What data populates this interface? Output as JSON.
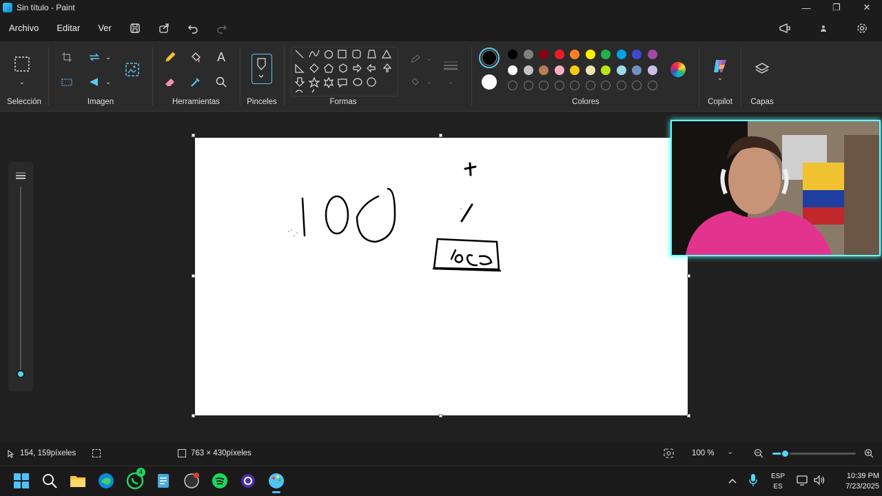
{
  "window": {
    "title": "Sin título - Paint",
    "minimize": "—",
    "maximize": "❐",
    "close": "✕"
  },
  "menu": {
    "file": "Archivo",
    "edit": "Editar",
    "view": "Ver"
  },
  "ribbon": {
    "selection": "Selección",
    "image": "Imagen",
    "tools": "Herramientas",
    "brushes": "Pinceles",
    "shapes": "Formas",
    "colors": "Colores",
    "copilot": "Copilot",
    "layers": "Capas"
  },
  "colors": {
    "primary": "#000000",
    "secondary": "#ffffff",
    "row1": [
      "#000000",
      "#7f7f7f",
      "#880015",
      "#ed1c24",
      "#ff7f27",
      "#fff200",
      "#22b14c",
      "#00a2e8",
      "#3f48cc",
      "#a349a4"
    ],
    "row2": [
      "#ffffff",
      "#c3c3c3",
      "#b97a57",
      "#ffaec9",
      "#ffc90e",
      "#efe4b0",
      "#b5e61d",
      "#99d9ea",
      "#7092be",
      "#c8bfe7"
    ]
  },
  "canvas_text": {
    "number": "100",
    "plus": "+",
    "slash": "/",
    "boxed": "%"
  },
  "status": {
    "cursor_pos": "154, 159píxeles",
    "canvas_size": "763 × 430píxeles",
    "zoom": "100 %"
  },
  "taskbar": {
    "lang_top": "ESP",
    "lang_bottom": "ES",
    "time": "10:39 PM",
    "date": "7/23/2025",
    "whatsapp_badge": "4"
  }
}
